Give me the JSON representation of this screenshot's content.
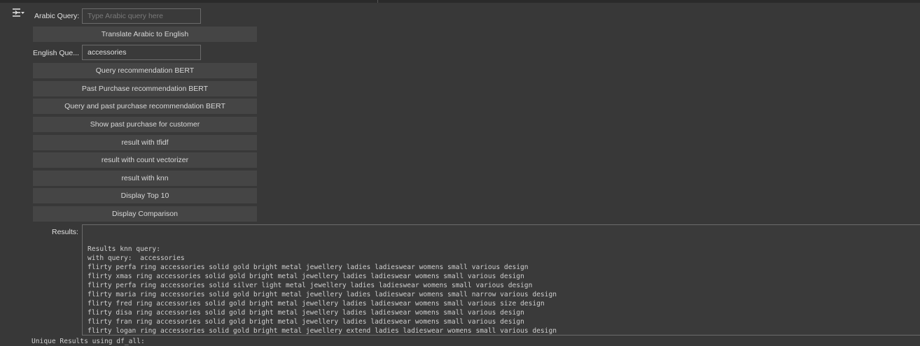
{
  "widgets": {
    "arabic_query": {
      "label": "Arabic Query:",
      "value": "",
      "placeholder": "Type Arabic query here"
    },
    "translate_button": "Translate Arabic to English",
    "english_query": {
      "label": "English Que...",
      "value": "accessories",
      "placeholder": ""
    },
    "buttons": {
      "query_bert": "Query recommendation BERT",
      "past_purchase_bert": "Past Purchase recommendation BERT",
      "query_past_bert": "Query and past purchase recommendation BERT",
      "show_past_purchase": "Show past purchase for customer",
      "result_tfidf": "result with tfidf",
      "result_count_vectorizer": "result with count vectorizer",
      "result_knn": "result with knn",
      "display_top10": "Display Top 10",
      "display_comparison": "Display Comparison"
    },
    "results": {
      "label": "Results:",
      "lines": [
        "Results knn query:",
        "with query:  accessories",
        "flirty perfa ring accessories solid gold bright metal jewellery ladies ladieswear womens small various design",
        "flirty xmas ring accessories solid gold bright metal jewellery ladies ladieswear womens small various design",
        "flirty perfa ring accessories solid silver light metal jewellery ladies ladieswear womens small various design",
        "flirty maria ring accessories solid gold bright metal jewellery ladies ladieswear womens small narrow various design",
        "flirty fred ring accessories solid gold bright metal jewellery ladies ladieswear womens small various size design",
        "flirty disa ring accessories solid gold bright metal jewellery ladies ladieswear womens small various design",
        "flirty fran ring accessories solid gold bright metal jewellery ladies ladieswear womens small various design",
        "flirty logan ring accessories solid gold bright metal jewellery extend ladies ladieswear womens small various design"
      ]
    }
  },
  "output": {
    "trailing_text": "Unique Results using df_all:"
  }
}
